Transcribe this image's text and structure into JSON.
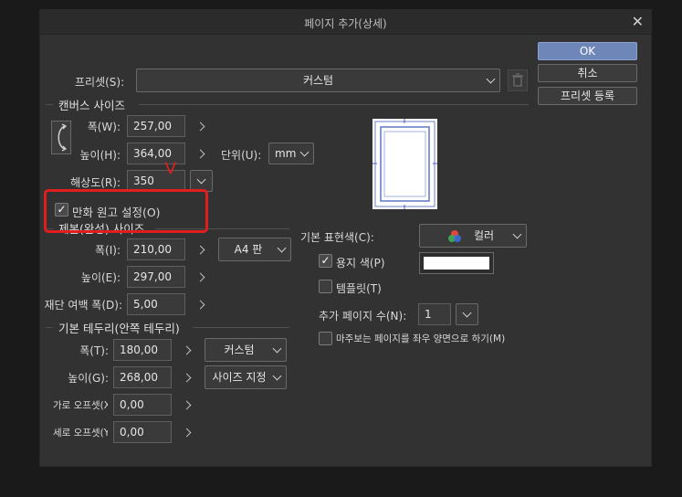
{
  "dialog": {
    "title": "페이지 추가(상세)",
    "close_icon": "close-icon"
  },
  "buttons": {
    "ok": "OK",
    "cancel": "취소",
    "register_preset": "프리셋 등록"
  },
  "preset": {
    "label": "프리셋(S):",
    "value": "커스텀",
    "delete_icon": "trash-icon"
  },
  "canvas": {
    "section": "캔버스 사이즈",
    "width_label": "폭(W):",
    "width_value": "257,00",
    "height_label": "높이(H):",
    "height_value": "364,00",
    "unit_label": "단위(U):",
    "unit_value": "mm",
    "resolution_label": "해상도(R):",
    "resolution_value": "350"
  },
  "manga": {
    "label": "만화 원고 설정(O)",
    "checked": true
  },
  "finish": {
    "section": "제본(완성) 사이즈",
    "width_label": "폭(I):",
    "width_value": "210,00",
    "preset_value": "A4 판",
    "height_label": "높이(E):",
    "height_value": "297,00",
    "bleed_label": "재단 여백 폭(D):",
    "bleed_value": "5,00"
  },
  "frame": {
    "section": "기본 테두리(안쪽 테두리)",
    "width_label": "폭(T):",
    "width_value": "180,00",
    "width_preset": "커스텀",
    "height_label": "높이(G):",
    "height_value": "268,00",
    "height_preset": "사이즈 지정",
    "offset_x_label": "가로 오프셋(X",
    "offset_x_value": "0,00",
    "offset_y_label": "세로 오프셋(Y",
    "offset_y_value": "0,00"
  },
  "color": {
    "label": "기본 표현색(C):",
    "value": "컬러",
    "paper_color_label": "용지 색(P)",
    "paper_color_checked": true,
    "paper_color": "#ffffff",
    "template_label": "템플릿(T)",
    "template_checked": false,
    "add_pages_label": "추가 페이지 수(N):",
    "add_pages_value": "1",
    "spread_label": "마주보는 페이지를 좌우 양면으로 하기(M)",
    "spread_checked": false
  },
  "annotation": {
    "color": "#e01e1e",
    "mark": "V"
  }
}
